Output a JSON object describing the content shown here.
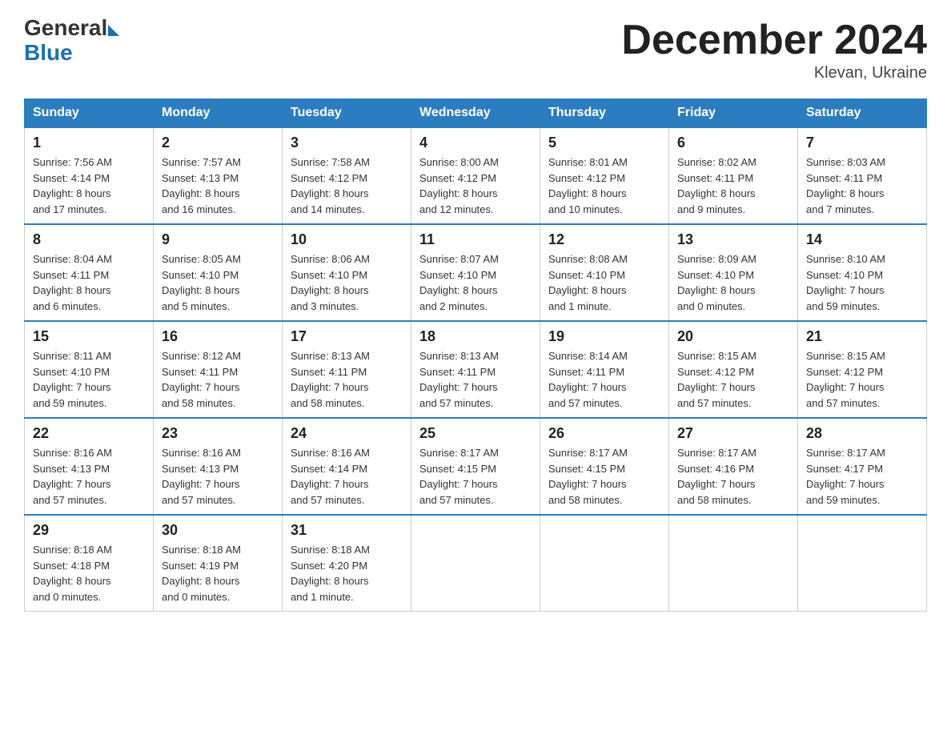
{
  "header": {
    "logo_general": "General",
    "logo_blue": "Blue",
    "month_title": "December 2024",
    "location": "Klevan, Ukraine"
  },
  "days_of_week": [
    "Sunday",
    "Monday",
    "Tuesday",
    "Wednesday",
    "Thursday",
    "Friday",
    "Saturday"
  ],
  "weeks": [
    [
      {
        "day": "1",
        "sunrise": "7:56 AM",
        "sunset": "4:14 PM",
        "daylight": "8 hours and 17 minutes."
      },
      {
        "day": "2",
        "sunrise": "7:57 AM",
        "sunset": "4:13 PM",
        "daylight": "8 hours and 16 minutes."
      },
      {
        "day": "3",
        "sunrise": "7:58 AM",
        "sunset": "4:12 PM",
        "daylight": "8 hours and 14 minutes."
      },
      {
        "day": "4",
        "sunrise": "8:00 AM",
        "sunset": "4:12 PM",
        "daylight": "8 hours and 12 minutes."
      },
      {
        "day": "5",
        "sunrise": "8:01 AM",
        "sunset": "4:12 PM",
        "daylight": "8 hours and 10 minutes."
      },
      {
        "day": "6",
        "sunrise": "8:02 AM",
        "sunset": "4:11 PM",
        "daylight": "8 hours and 9 minutes."
      },
      {
        "day": "7",
        "sunrise": "8:03 AM",
        "sunset": "4:11 PM",
        "daylight": "8 hours and 7 minutes."
      }
    ],
    [
      {
        "day": "8",
        "sunrise": "8:04 AM",
        "sunset": "4:11 PM",
        "daylight": "8 hours and 6 minutes."
      },
      {
        "day": "9",
        "sunrise": "8:05 AM",
        "sunset": "4:10 PM",
        "daylight": "8 hours and 5 minutes."
      },
      {
        "day": "10",
        "sunrise": "8:06 AM",
        "sunset": "4:10 PM",
        "daylight": "8 hours and 3 minutes."
      },
      {
        "day": "11",
        "sunrise": "8:07 AM",
        "sunset": "4:10 PM",
        "daylight": "8 hours and 2 minutes."
      },
      {
        "day": "12",
        "sunrise": "8:08 AM",
        "sunset": "4:10 PM",
        "daylight": "8 hours and 1 minute."
      },
      {
        "day": "13",
        "sunrise": "8:09 AM",
        "sunset": "4:10 PM",
        "daylight": "8 hours and 0 minutes."
      },
      {
        "day": "14",
        "sunrise": "8:10 AM",
        "sunset": "4:10 PM",
        "daylight": "7 hours and 59 minutes."
      }
    ],
    [
      {
        "day": "15",
        "sunrise": "8:11 AM",
        "sunset": "4:10 PM",
        "daylight": "7 hours and 59 minutes."
      },
      {
        "day": "16",
        "sunrise": "8:12 AM",
        "sunset": "4:11 PM",
        "daylight": "7 hours and 58 minutes."
      },
      {
        "day": "17",
        "sunrise": "8:13 AM",
        "sunset": "4:11 PM",
        "daylight": "7 hours and 58 minutes."
      },
      {
        "day": "18",
        "sunrise": "8:13 AM",
        "sunset": "4:11 PM",
        "daylight": "7 hours and 57 minutes."
      },
      {
        "day": "19",
        "sunrise": "8:14 AM",
        "sunset": "4:11 PM",
        "daylight": "7 hours and 57 minutes."
      },
      {
        "day": "20",
        "sunrise": "8:15 AM",
        "sunset": "4:12 PM",
        "daylight": "7 hours and 57 minutes."
      },
      {
        "day": "21",
        "sunrise": "8:15 AM",
        "sunset": "4:12 PM",
        "daylight": "7 hours and 57 minutes."
      }
    ],
    [
      {
        "day": "22",
        "sunrise": "8:16 AM",
        "sunset": "4:13 PM",
        "daylight": "7 hours and 57 minutes."
      },
      {
        "day": "23",
        "sunrise": "8:16 AM",
        "sunset": "4:13 PM",
        "daylight": "7 hours and 57 minutes."
      },
      {
        "day": "24",
        "sunrise": "8:16 AM",
        "sunset": "4:14 PM",
        "daylight": "7 hours and 57 minutes."
      },
      {
        "day": "25",
        "sunrise": "8:17 AM",
        "sunset": "4:15 PM",
        "daylight": "7 hours and 57 minutes."
      },
      {
        "day": "26",
        "sunrise": "8:17 AM",
        "sunset": "4:15 PM",
        "daylight": "7 hours and 58 minutes."
      },
      {
        "day": "27",
        "sunrise": "8:17 AM",
        "sunset": "4:16 PM",
        "daylight": "7 hours and 58 minutes."
      },
      {
        "day": "28",
        "sunrise": "8:17 AM",
        "sunset": "4:17 PM",
        "daylight": "7 hours and 59 minutes."
      }
    ],
    [
      {
        "day": "29",
        "sunrise": "8:18 AM",
        "sunset": "4:18 PM",
        "daylight": "8 hours and 0 minutes."
      },
      {
        "day": "30",
        "sunrise": "8:18 AM",
        "sunset": "4:19 PM",
        "daylight": "8 hours and 0 minutes."
      },
      {
        "day": "31",
        "sunrise": "8:18 AM",
        "sunset": "4:20 PM",
        "daylight": "8 hours and 1 minute."
      },
      null,
      null,
      null,
      null
    ]
  ],
  "labels": {
    "sunrise": "Sunrise:",
    "sunset": "Sunset:",
    "daylight": "Daylight:"
  }
}
